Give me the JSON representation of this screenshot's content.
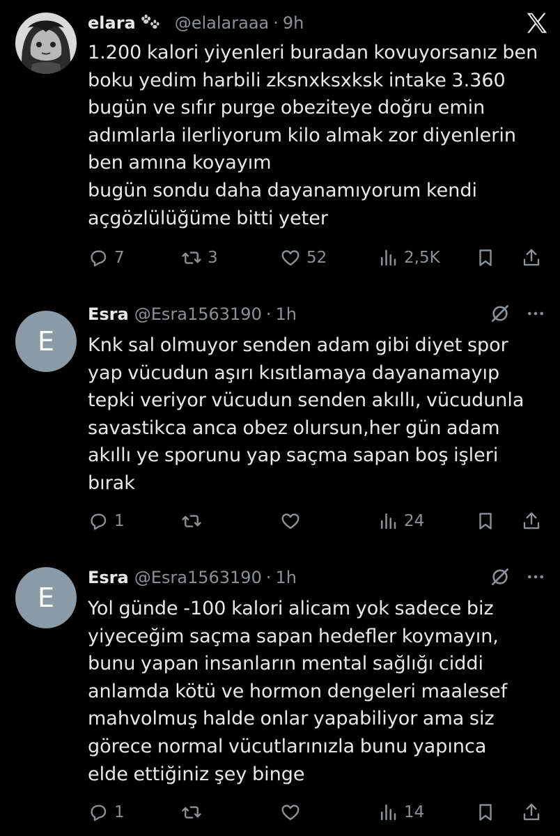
{
  "brand_logo": "x-logo-icon",
  "tweets": [
    {
      "author": "elara",
      "badge_icon": "paw-prints-icon",
      "handle": "@elalaraaa",
      "separator": "·",
      "time": "9h",
      "text": "1.200 kalori yiyenleri buradan kovuyorsanız ben\nboku yedim harbili zksnxksxksk intake 3.360\nbugün ve sıfır purge obeziteye doğru emin\nadımlarla ilerliyorum kilo almak zor diyenlerin\nben amına koyayım\nbugün sondu daha dayanamıyorum kendi\naçgözlülüğüme bitti yeter",
      "actions": {
        "replies": "7",
        "reposts": "3",
        "likes": "52",
        "views": "2,5K"
      }
    },
    {
      "author": "Esra",
      "avatar_letter": "E",
      "handle": "@Esra1563190",
      "separator": "·",
      "time": "1h",
      "text": "Knk sal olmuyor senden adam gibi diyet spor\nyap vücudun aşırı kısıtlamaya dayanamayıp\ntepki veriyor vücudun senden akıllı, vücudunla\nsavastikca anca obez olursun,her gün adam\nakıllı ye sporunu yap saçma sapan boş işleri\nbırak",
      "actions": {
        "replies": "1",
        "reposts": "",
        "likes": "",
        "views": "24"
      }
    },
    {
      "author": "Esra",
      "avatar_letter": "E",
      "handle": "@Esra1563190",
      "separator": "·",
      "time": "1h",
      "text": "Yol günde -100 kalori alicam yok sadece biz\nyiyeceğim saçma sapan hedefler koymayın,\nbunu yapan insanların mental sağlığı ciddi\nanlamda kötü ve hormon dengeleri maalesef\nmahvolmuş halde onlar yapabiliyor ama siz\ngörece normal vücutlarınızla bunu yapınca\nelde ettiğiniz  şey binge",
      "actions": {
        "replies": "1",
        "reposts": "",
        "likes": "",
        "views": "14"
      }
    }
  ]
}
